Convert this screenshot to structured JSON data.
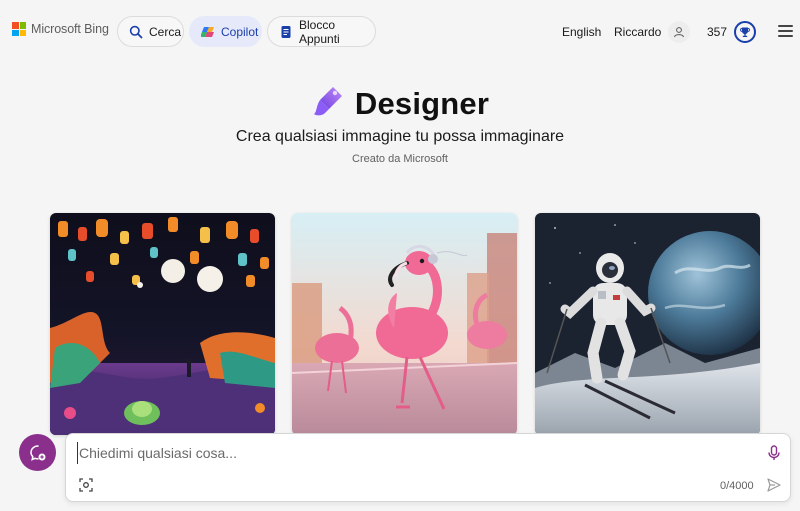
{
  "header": {
    "logo_text": "Microsoft Bing",
    "nav": [
      {
        "label": "Cerca",
        "icon": "search-icon"
      },
      {
        "label": "Copilot",
        "icon": "copilot-icon"
      },
      {
        "label": "Blocco Appunti",
        "icon": "notebook-icon"
      }
    ],
    "language": "English",
    "user_name": "Riccardo",
    "points": "357",
    "menu_icon": "hamburger-icon",
    "colors": {
      "accent": "#1a3faa",
      "copilot_bg": "#e6e9f9"
    }
  },
  "hero": {
    "title": "Designer",
    "subtitle": "Crea qualsiasi immagine tu possa immaginare",
    "credit": "Creato da Microsoft"
  },
  "gallery": [
    {
      "name": "lantern-forest-image"
    },
    {
      "name": "flamingo-headphones-image"
    },
    {
      "name": "astronaut-skiing-image"
    }
  ],
  "chat": {
    "placeholder": "Chiedimi qualsiasi cosa...",
    "counter": "0/4000",
    "avatar_color": "#8a2f8c"
  }
}
